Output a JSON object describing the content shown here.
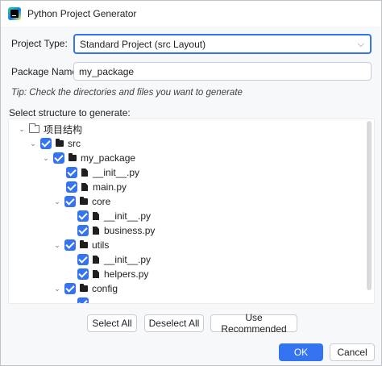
{
  "window": {
    "title": "Python Project Generator"
  },
  "project_type": {
    "label": "Project Type:",
    "value": "Standard Project (src Layout)"
  },
  "package_name": {
    "label": "Package Name:",
    "value": "my_package"
  },
  "tip": "Tip: Check the directories and files you want to generate",
  "structure_label": "Select structure to generate:",
  "tree": {
    "root": "项目结构",
    "src": "src",
    "my_package": "my_package",
    "pkg_init": "__init__.py",
    "main": "main.py",
    "core": "core",
    "core_init": "__init__.py",
    "business": "business.py",
    "utils": "utils",
    "utils_init": "__init__.py",
    "helpers": "helpers.py",
    "config": "config"
  },
  "buttons": {
    "select_all": "Select All",
    "deselect_all": "Deselect All",
    "use_recommended": "Use Recommended",
    "ok": "OK",
    "cancel": "Cancel"
  },
  "colors": {
    "accent": "#3574f0",
    "background": "#f7f8fa"
  }
}
